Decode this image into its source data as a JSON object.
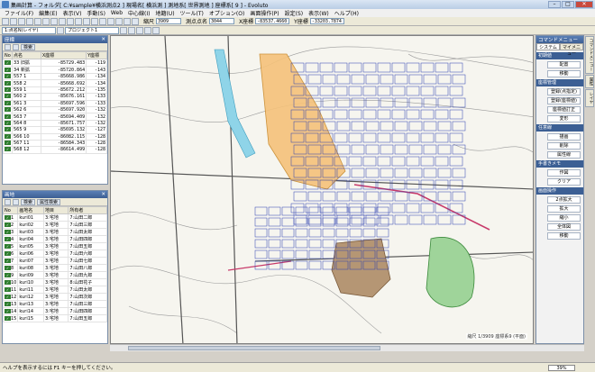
{
  "window": {
    "title": "集画計算 - フォルダ[ C:¥sample¥横浜測点2 ] 現場名[ 横浜測 ] 測地系[ 世界測地 ] 座標系[ 9 ] - Evoluto",
    "minimize": "–",
    "maximize": "□",
    "close": "✕"
  },
  "menu": [
    "ファイル(F)",
    "編集(E)",
    "表示(V)",
    "手動(S)",
    "Web",
    "中心線(I)",
    "地籍(U)",
    "ツール(T)",
    "オプション(O)",
    "画面操作(P)",
    "設定(S)",
    "表示(W)",
    "ヘルプ(H)"
  ],
  "toolbar": {
    "scale_label": "縮尺",
    "scale_value": "3909",
    "point_label": "測点点名",
    "point_value": "3044",
    "x_label": "X座標",
    "x_value": "-83537.4660",
    "y_label": "Y座標",
    "y_value": "-33203.7874"
  },
  "toolbar2": {
    "layer_select": "1:点名N(レイヤ)",
    "project_select": "プロジェクト1"
  },
  "points_panel": {
    "title": "座標",
    "search_label": "検索",
    "columns": [
      "No",
      "点名",
      "X座標",
      "Y座標"
    ],
    "rows": [
      {
        "no": "",
        "name": "33 旧拡",
        "x": "-85729.483",
        "y": "-119"
      },
      {
        "no": "",
        "name": "34 新拡",
        "x": "-85720.864",
        "y": "-143"
      },
      {
        "no": "",
        "name": "557 1",
        "x": "-85668.986",
        "y": "-134"
      },
      {
        "no": "",
        "name": "558 2",
        "x": "-85668.692",
        "y": "-134"
      },
      {
        "no": "",
        "name": "559 1",
        "x": "-85672.212",
        "y": "-135"
      },
      {
        "no": "",
        "name": "560 2",
        "x": "-85676.161",
        "y": "-133"
      },
      {
        "no": "",
        "name": "561 3",
        "x": "-85697.596",
        "y": "-133"
      },
      {
        "no": "",
        "name": "562 6",
        "x": "-85697.920",
        "y": "-132"
      },
      {
        "no": "",
        "name": "563 7",
        "x": "-85694.409",
        "y": "-132"
      },
      {
        "no": "",
        "name": "564 8",
        "x": "-85671.757",
        "y": "-132"
      },
      {
        "no": "",
        "name": "565 9",
        "x": "-85695.132",
        "y": "-127"
      },
      {
        "no": "",
        "name": "566 10",
        "x": "-86082.115",
        "y": "-128"
      },
      {
        "no": "",
        "name": "567 11",
        "x": "-86584.343",
        "y": "-128"
      },
      {
        "no": "",
        "name": "568 12",
        "x": "-86614.499",
        "y": "-128"
      }
    ]
  },
  "lots_panel": {
    "title": "画地",
    "search_label": "検索",
    "attr_label": "属性検索",
    "columns": [
      "No",
      "画地名",
      "地目",
      "所有者"
    ],
    "rows": [
      {
        "no": "1",
        "name": "kuri01",
        "type": "3:宅地",
        "owner": "7:山田二郎"
      },
      {
        "no": "2",
        "name": "kuri02",
        "type": "3:宅地",
        "owner": "7:山田三郎"
      },
      {
        "no": "3",
        "name": "kuri03",
        "type": "3:宅地",
        "owner": "7:山田太郎"
      },
      {
        "no": "4",
        "name": "kuri04",
        "type": "3:宅地",
        "owner": "7:山田四郎"
      },
      {
        "no": "5",
        "name": "kuri05",
        "type": "3:宅地",
        "owner": "7:山田五郎"
      },
      {
        "no": "6",
        "name": "kuri06",
        "type": "3:宅地",
        "owner": "7:山田六郎"
      },
      {
        "no": "7",
        "name": "kuri07",
        "type": "3:宅地",
        "owner": "7:山田七郎"
      },
      {
        "no": "8",
        "name": "kuri08",
        "type": "3:宅地",
        "owner": "7:山田八郎"
      },
      {
        "no": "9",
        "name": "kuri09",
        "type": "3:宅地",
        "owner": "7:山田九郎"
      },
      {
        "no": "10",
        "name": "kuri10",
        "type": "3:宅地",
        "owner": "8:山田花子"
      },
      {
        "no": "11",
        "name": "kuri11",
        "type": "3:宅地",
        "owner": "7:山田太郎"
      },
      {
        "no": "12",
        "name": "kuri12",
        "type": "3:宅地",
        "owner": "7:山田次郎"
      },
      {
        "no": "13",
        "name": "kuri13",
        "type": "3:宅地",
        "owner": "7:山田三郎"
      },
      {
        "no": "14",
        "name": "kuri14",
        "type": "3:宅地",
        "owner": "7:山田四郎"
      },
      {
        "no": "15",
        "name": "kuri15",
        "type": "3:宅地",
        "owner": "7:山田五郎"
      }
    ]
  },
  "command_menu": {
    "title": "コマンドメニュー",
    "tabs": [
      "システム",
      "マイメニュー"
    ],
    "sections": [
      {
        "title": "初期値",
        "buttons": [
          "配置",
          "移動"
        ]
      },
      {
        "title": "座標管理",
        "buttons": [
          "登録(点指定)",
          "登録(座標値)",
          "座標値訂正",
          "変形"
        ]
      },
      {
        "title": "任意線",
        "buttons": [
          "描画",
          "削除",
          "属性線"
        ]
      },
      {
        "title": "手書きメモ",
        "buttons": [
          "作図",
          "クリア"
        ]
      },
      {
        "title": "画面操作",
        "buttons": [
          "2点拡大",
          "拡大",
          "縮小",
          "全体図",
          "移動"
        ]
      }
    ]
  },
  "side_tabs": [
    "コマンドメニュー",
    "属性",
    "レイヤ"
  ],
  "map": {
    "scale_text": "縮尺 1/3909 座標系9 (平面)"
  },
  "status": {
    "help_text": "ヘルプを表示するには F1 キーを押してください。",
    "progress": "39%"
  },
  "colors": {
    "titlebar": "#b9cde5",
    "panel_header": "#3c5f94",
    "lot_line": "#2a3fb0",
    "orange_area": "#f5c27a",
    "green_area": "#9fd49a",
    "brown_area": "#b59674",
    "road_red": "#c83a6a"
  }
}
